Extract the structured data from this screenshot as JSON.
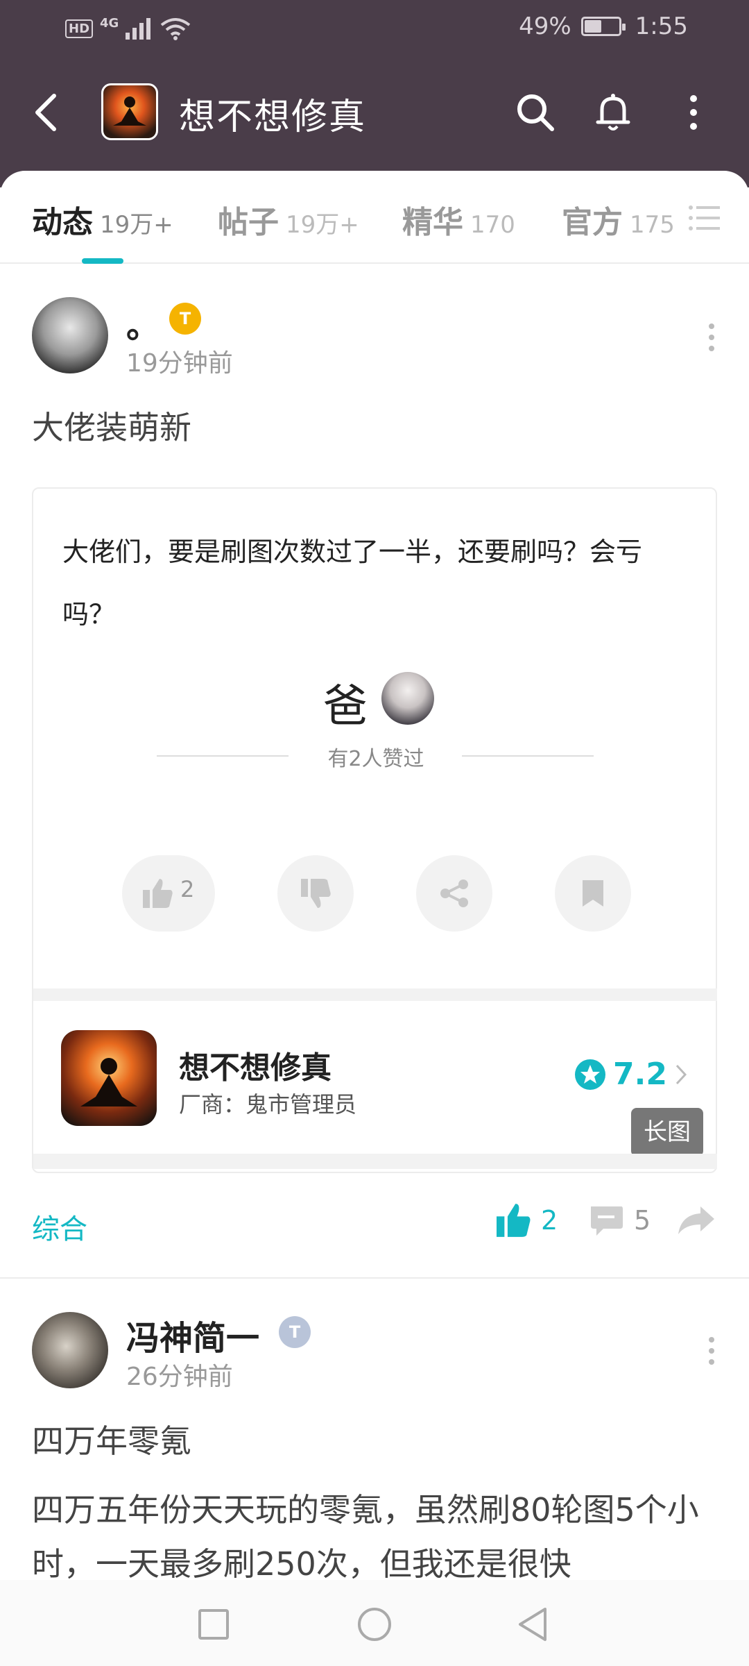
{
  "status": {
    "network": "4G",
    "hd": "HD",
    "battery_text": "49%",
    "battery_level": 0.49,
    "time": "1:55"
  },
  "header": {
    "title": "想不想修真"
  },
  "tabs": [
    {
      "label": "动态",
      "count": "19万+",
      "active": true
    },
    {
      "label": "帖子",
      "count": "19万+",
      "active": false
    },
    {
      "label": "精华",
      "count": "170",
      "active": false
    },
    {
      "label": "官方",
      "count": "175",
      "active": false
    }
  ],
  "post1": {
    "username": "。",
    "time": "19分钟前",
    "title": "大佬装萌新",
    "content": "大佬们，要是刷图次数过了一半，还要刷吗？会亏吗？",
    "liker_name": "爸",
    "liked_text": "有2人赞过",
    "inner_like_count": "2",
    "game": {
      "name": "想不想修真",
      "vendor": "厂商：鬼市管理员",
      "rating": "7.2"
    },
    "long_image_label": "长图",
    "category": "综合",
    "likes": "2",
    "comments": "5"
  },
  "post2": {
    "username": "冯神简一",
    "time": "26分钟前",
    "title": "四万年零氪",
    "content": "四万五年份天天玩的零氪，虽然刷80轮图5个小时，一天最多刷250次，但我还是很快"
  },
  "colors": {
    "header_bg": "#4a3d49",
    "accent": "#14b8c4",
    "badge_gold": "#f5b301",
    "badge_silver": "#b9c4d9"
  }
}
